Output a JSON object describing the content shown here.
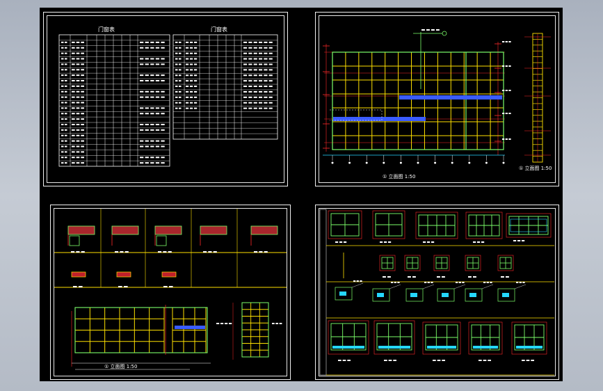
{
  "sheets": {
    "top_left": {
      "left_table_title": "门窗表",
      "right_table_title": "门窗表"
    },
    "top_right": {
      "main_caption": "① 立面图 1:50",
      "side_caption": "① 立面图 1:50"
    },
    "bottom_left": {
      "main_caption": "① 立面图 1:50"
    }
  },
  "colors": {
    "background": "#000000",
    "sheet_border": "#ffffff",
    "grid_yellow": "#ffe100",
    "frame_green": "#7cff6a",
    "axis_red": "#ff2a2a",
    "glass_blue": "#3a5cff",
    "dim_cyan": "#25d7ff",
    "panel_red": "#c0202a"
  }
}
